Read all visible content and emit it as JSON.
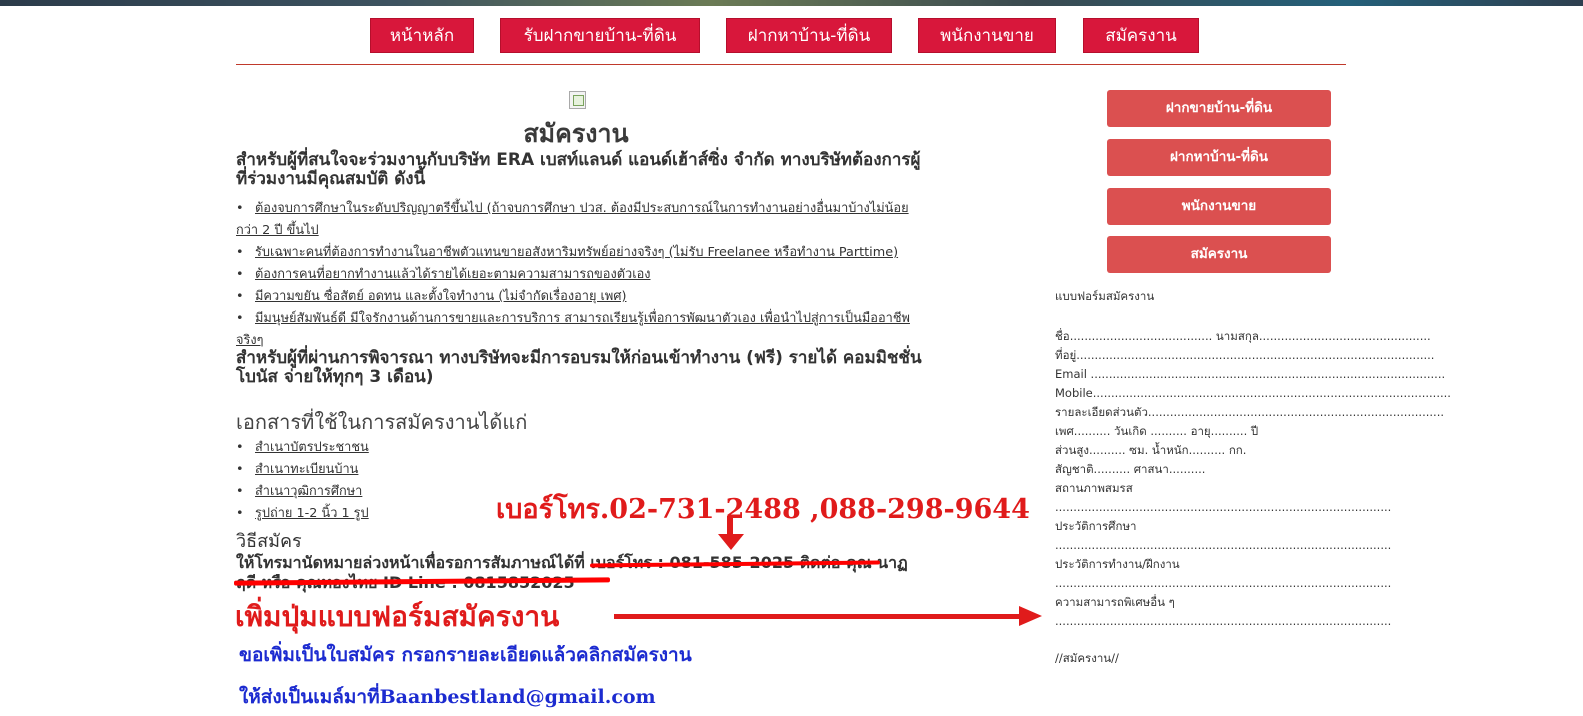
{
  "nav": {
    "items": [
      "หน้าหลัก",
      "รับฝากขายบ้าน-ที่ดิน",
      "ฝากหาบ้าน-ที่ดิน",
      "พนักงานขาย",
      "สมัครงาน"
    ]
  },
  "main": {
    "title": "สมัครงาน",
    "intro": "สำหรับผู้ที่สนใจจะร่วมงานกับบริษัท ERA เบสท์แลนด์ แอนด์เฮ้าส์ซิ่ง จำกัด ทางบริษัทต้องการผู้ที่ร่วมงานมีคุณสมบัติ ดังนี้",
    "requirements": [
      "ต้องจบการศึกษาในระดับปริญญาตรีขึ้นไป (ถ้าจบการศึกษา ปวส. ต้องมีประสบการณ์ในการทำงานอย่างอื่นมาบ้างไม่น้อยกว่า 2 ปี ขึ้นไป",
      "รับเฉพาะคนที่ต้องการทำงานในอาชีพตัวแทนขายอสังหาริมทรัพย์อย่างจริงๆ (ไม่รับ Freelanee หรือทำงาน Parttime)",
      "ต้องการคนที่อยากทำงานแล้วได้รายได้เยอะตามความสามารถของตัวเอง",
      "มีความขยัน ซื่อสัตย์ อดทน และตั้งใจทำงาน (ไม่จำกัดเรื่องอายุ เพศ)",
      "มีมนุษย์สัมพันธ์ดี มีใจรักงานด้านการขายและการบริการ สามารถเรียนรู้เพื่อการพัฒนาตัวเอง เพื่อนำไปสู่การเป็นมืออาชีพจริงๆ"
    ],
    "training": "สำหรับผู้ที่ผ่านการพิจารณา ทางบริษัทจะมีการอบรมให้ก่อนเข้าทำงาน (ฟรี) รายได้ คอมมิชชั่น โบนัส จ่ายให้ทุกๆ 3 เดือน)",
    "docs_heading": "เอกสารที่ใช้ในการสมัครงานได้แก่",
    "docs": [
      "สำเนาบัตรประชาชน",
      "สำเนาทะเบียนบ้าน",
      "สำเนาวุฒิการศึกษา",
      "รูปถ่าย 1-2 นิ้ว 1 รูป"
    ],
    "how_heading": "วิธีสมัคร",
    "how_text": "ให้โทรมานัดหมายล่วงหน้าเพื่อรอการสัมภาษณ์ได้ที่",
    "how_struck": "เบอร์โทร : 081-585-2025 ติดต่อ คุณ นาฏฤดี หรือ คุณทองไทย ID Line : 0815852025"
  },
  "annotations": {
    "phone": "เบอร์โทร.02-731-2488 ,088-298-9644",
    "add_button": "เพิ่มปุ่มแบบฟอร์มสมัครงาน",
    "note1": "ขอเพิ่มเป็นใบสมัคร กรอกรายละเอียดแล้วคลิกสมัครงาน",
    "note2": "ให้ส่งเป็นเมล์มาที่Baanbestland@gmail.com"
  },
  "sidebar": {
    "buttons": [
      "ฝากขายบ้าน-ที่ดิน",
      "ฝากหาบ้าน-ที่ดิน",
      "พนักงานขาย",
      "สมัครงาน"
    ]
  },
  "form": {
    "title": "แบบฟอร์มสมัครงาน",
    "rows": [
      "ชื่อ....................................... นามสกุล...............................................",
      "ที่อยู่..................................................................................................",
      "Email .................................................................................................",
      "Mobile..................................................................................................",
      "รายละเอียดส่วนตัว.................................................................................",
      "เพศ.......... วันเกิด .......... อายุ.......... ปี",
      "ส่วนสูง.......... ซม. น้ำหนัก.......... กก.",
      "สัญชาติ.......... ศาสนา..........",
      "สถานภาพสมรส",
      "............................................................................................",
      "ประวัติการศึกษา",
      "............................................................................................",
      "ประวัติการทำงาน/ฝึกงาน",
      "............................................................................................",
      "ความสามารถพิเศษอื่น ๆ",
      "............................................................................................",
      "//สมัครงาน//"
    ]
  },
  "colors": {
    "nav_red": "#d8173b",
    "side_red": "#db5050",
    "annotation_red": "#e01b1b",
    "annotation_blue": "#1c2bd0"
  }
}
